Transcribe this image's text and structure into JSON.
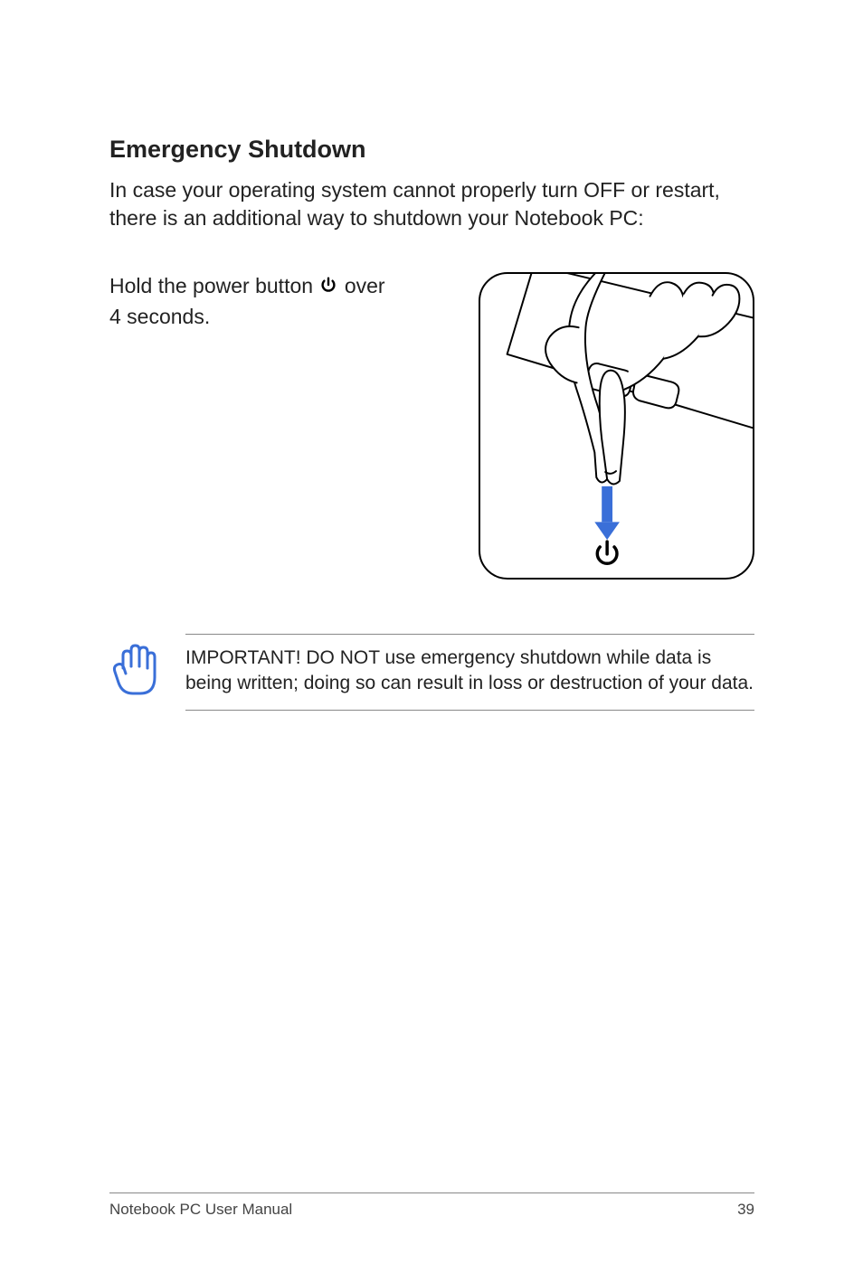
{
  "heading": "Emergency Shutdown",
  "intro": "In case your operating system cannot properly turn OFF or restart, there is an additional way to shutdown your Notebook PC:",
  "instruction_pre": "Hold the power button ",
  "instruction_post": " over 4 seconds.",
  "note": "IMPORTANT!  DO NOT use emergency shutdown while data is being written; doing so can result in loss or destruction of your data.",
  "footer_left": "Notebook PC User Manual",
  "footer_right": "39"
}
